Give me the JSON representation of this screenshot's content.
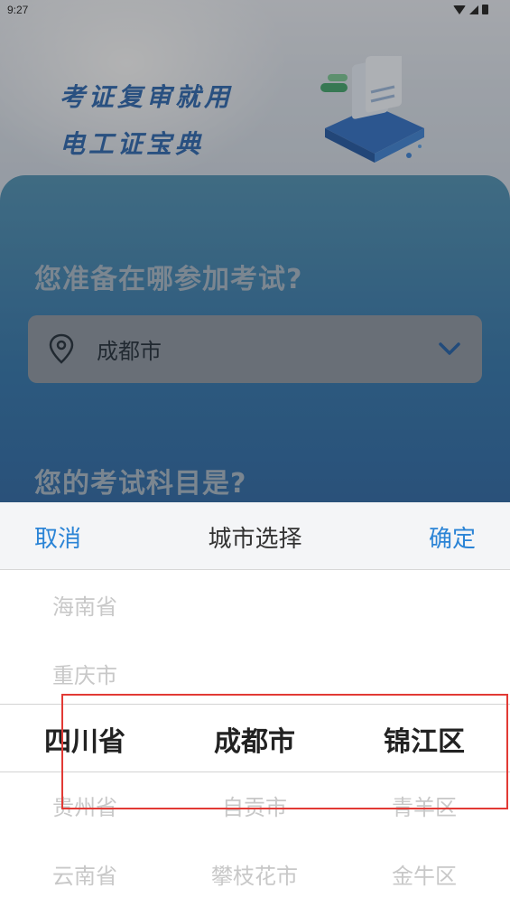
{
  "status_bar": {
    "time": "9:27"
  },
  "banner": {
    "title_line1": "考证复审就用",
    "title_line2": "电工证宝典"
  },
  "main": {
    "question_location": "您准备在哪参加考试?",
    "location_value": "成都市",
    "question_subject": "您的考试科目是?"
  },
  "picker": {
    "cancel_label": "取消",
    "title": "城市选择",
    "confirm_label": "确定",
    "provinces": [
      "海南省",
      "重庆市",
      "四川省",
      "贵州省",
      "云南省"
    ],
    "cities": [
      "",
      "",
      "成都市",
      "自贡市",
      "攀枝花市"
    ],
    "districts": [
      "",
      "",
      "锦江区",
      "青羊区",
      "金牛区"
    ],
    "selected": {
      "province": "四川省",
      "city": "成都市",
      "district": "锦江区"
    }
  },
  "colors": {
    "accent": "#2b84d6",
    "highlight": "#e23a35",
    "banner_text": "#2a66b0"
  }
}
